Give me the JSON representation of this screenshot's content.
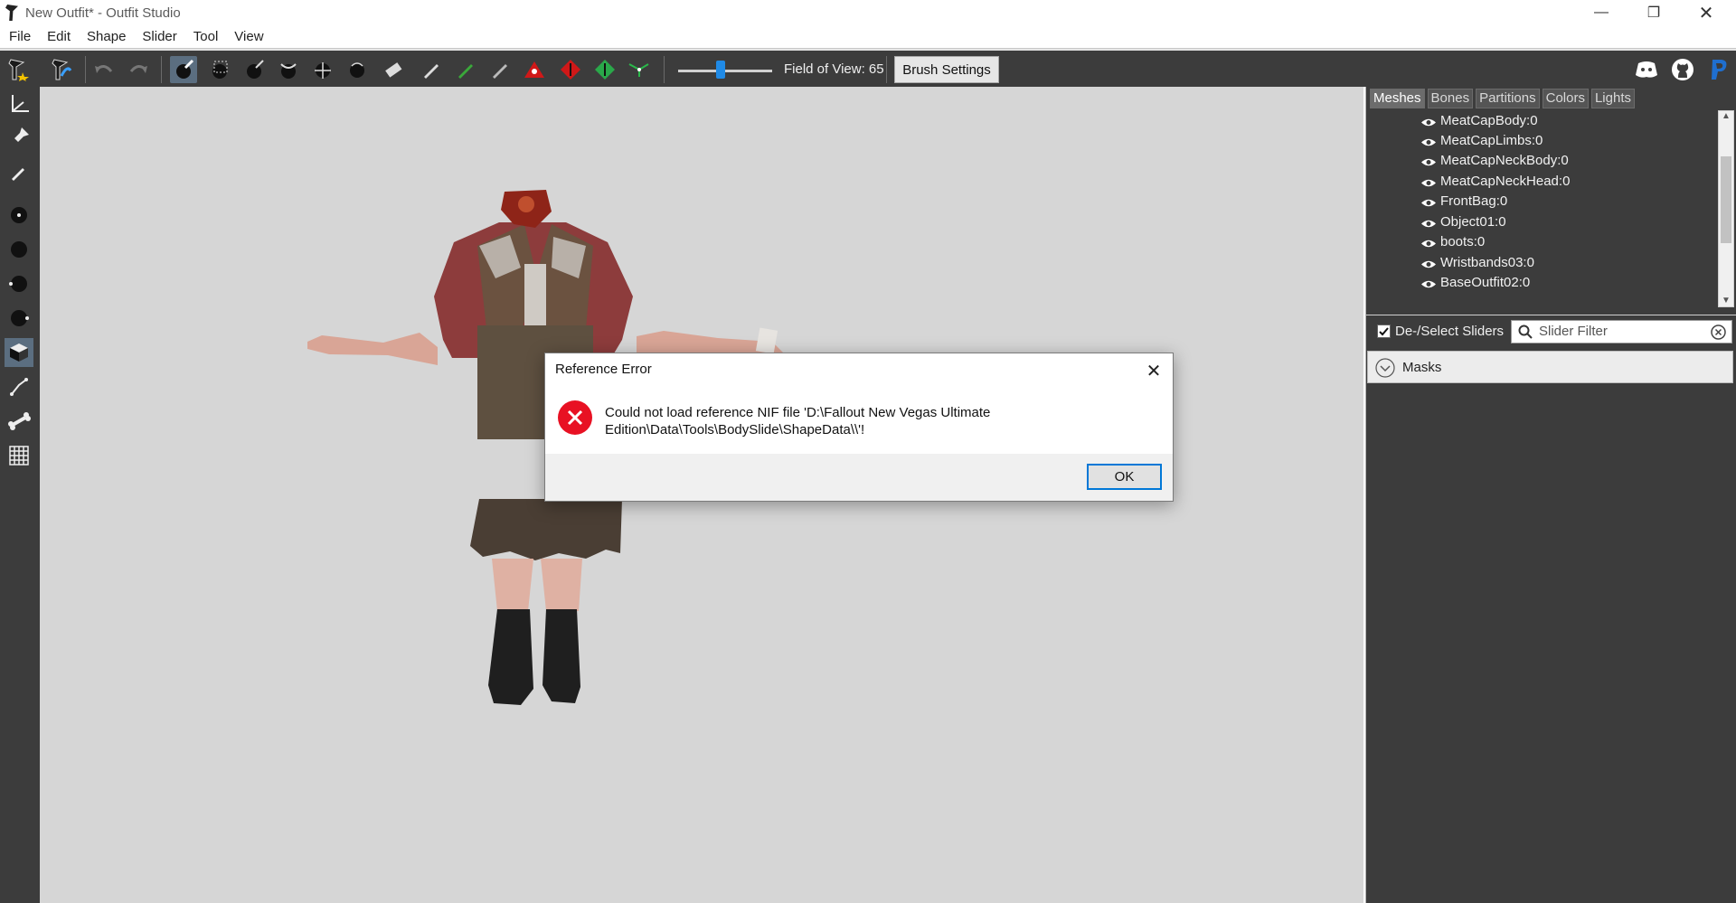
{
  "window": {
    "title": "New Outfit* - Outfit Studio"
  },
  "menu": [
    "File",
    "Edit",
    "Shape",
    "Slider",
    "Tool",
    "View"
  ],
  "toolbar": {
    "fov_label": "Field of View: 65",
    "brush_settings_label": "Brush Settings",
    "fov_value": 65
  },
  "tabs": [
    "Meshes",
    "Bones",
    "Partitions",
    "Colors",
    "Lights"
  ],
  "meshes": [
    "MeatCapBody:0",
    "MeatCapLimbs:0",
    "MeatCapNeckBody:0",
    "MeatCapNeckHead:0",
    "FrontBag:0",
    "Object01:0",
    "boots:0",
    "Wristbands03:0",
    "BaseOutfit02:0"
  ],
  "sliders": {
    "select_label": "De-/Select Sliders",
    "filter_placeholder": "Slider Filter",
    "masks_label": "Masks"
  },
  "dialog": {
    "title": "Reference Error",
    "message_line1": "Could not load reference NIF file 'D:\\Fallout New Vegas Ultimate",
    "message_line2": "Edition\\Data\\Tools\\BodySlide\\ShapeData\\\\'!",
    "ok_label": "OK"
  },
  "colors": {
    "accent": "#0078d7",
    "error": "#e81123",
    "panel": "#3c3c3c",
    "viewport": "#d6d6d6"
  }
}
